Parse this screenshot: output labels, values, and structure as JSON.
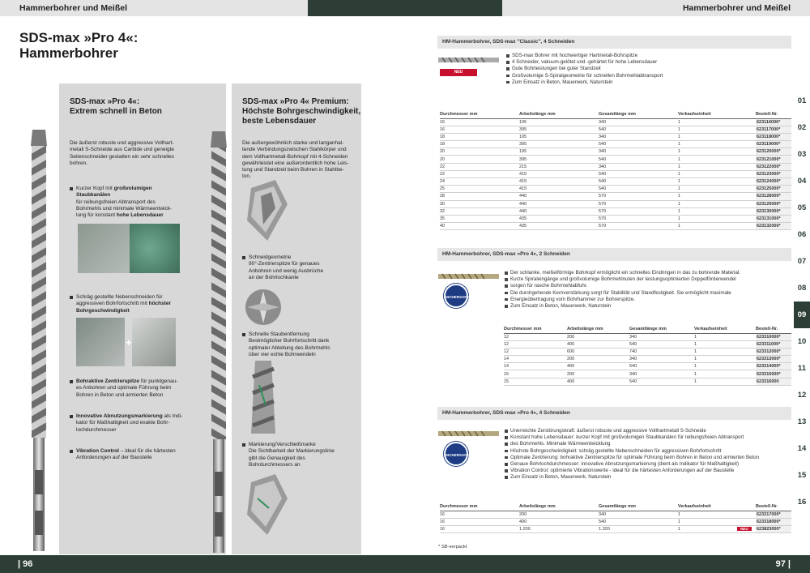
{
  "header": {
    "left_title": "Hammerbohrer und Meißel",
    "right_title": "Hammerbohrer und Meißel"
  },
  "footer": {
    "left_page": "| 96",
    "right_page": "97 |"
  },
  "main_title": {
    "line1": "SDS-max »Pro 4«:",
    "line2": "Hammerbohrer"
  },
  "col1": {
    "heading": [
      "SDS-max »Pro 4«:",
      "Extrem schnell in Beton"
    ],
    "intro": [
      "Die äußerst robuste und aggressive Voll­hart-",
      "metall S-Schneide aus Carbide und geneigte",
      "Seitenschneider gestatten ein sehr schnelles",
      "bohren."
    ],
    "b1_lines": [
      "Kurzer Kopf mit",
      "großvolumigen",
      "Staubkanälen",
      "für reibungsfreien Abtransport des",
      "Bohrmehls und minimale Wärmeentwick-",
      "lung für konstant",
      "hohe Lebensdauer"
    ],
    "b2_lines": [
      "Schräg gestellte Nebenschneiden für",
      "aggressiven Bohrfortschritt mit",
      "höchster",
      "Bohrgeschwindigkeit"
    ],
    "b3_lines": [
      "Bohraktive Zentrierspitze",
      "für punktgenau-",
      "es Anbohren und optimale Führung beim",
      "Bohren in Beton und armierten Beton"
    ],
    "b4_lines": [
      "Innovative Abnutzungsmarkierung",
      "als Indi-",
      "kator für Maßhaltigkeit und exakte Bohr-",
      "lochdurchmesser"
    ],
    "b5_lines": [
      "Vibration Control",
      "– ideal für die härtesten",
      "Anforderungen auf der Baustelle"
    ]
  },
  "col2": {
    "heading": [
      "SDS-max »Pro 4« Premium:",
      "Höchste Bohrgeschwindigkeit,",
      "beste Lebensdauer"
    ],
    "intro": [
      "Die außergewöhnlich starke und langanhal-",
      "tende Verbindungszwischen Stahlkörper und",
      "dem Vollhartmetall-Bohrkopf mit 4-Schneiden",
      "gewährleistet eine außerordentlich hohe Leis-",
      "tung und Standzeit beim Bohren in Stahlbe-",
      "ton."
    ],
    "b1": [
      "Schneidgeometrie",
      "90°-Zentrierspitze für genaues",
      "Anbohren und wenig Ausbrüche",
      "an der Bohrlochkante"
    ],
    "b2": [
      "Schnelle Staubentfernung",
      "Bestmöglicher Bohrfortschritt dank",
      "optimaler Ableitung des Bohrmehls",
      "über vier echte Bohrwendeln"
    ],
    "b3": [
      "Markierung/Verschleißmarke",
      "Die Sichtbarkeit der Markierungslinie",
      "gibt die Genauigkeit des",
      "Bohrdurchmessers an"
    ]
  },
  "sec1": {
    "title": "HM-Hammerbohrer, SDS-max \"Classic\", 4 Schneiden",
    "neu": "NEU",
    "bullets": [
      "SDS-max Bohrer mit hochwertiger Hartmetall-Bohrspitze",
      "4 Schneider, vakuum-gelötet und -gehärtet für hohe Lebensdauer",
      "Gute Bohrleistungen bei guter Standzeit",
      "Großvolumige S-Spiralgeometrie für schnellen Bohrmehlabtransport",
      "Zum Einsatz in Beton, Mauerwerk, Naturstein"
    ],
    "headers": [
      "Durchmesser mm",
      "Arbeitslänge mm",
      "Gesamtlänge mm",
      "Verkaufseinheit",
      "Bestell-Nr."
    ],
    "rows": [
      [
        "16",
        "195",
        "340",
        "1",
        "623116000*"
      ],
      [
        "16",
        "395",
        "540",
        "1",
        "623117000*"
      ],
      [
        "18",
        "195",
        "340",
        "1",
        "623118000*"
      ],
      [
        "18",
        "395",
        "540",
        "1",
        "623119000*"
      ],
      [
        "20",
        "195",
        "340",
        "1",
        "623120000*"
      ],
      [
        "20",
        "395",
        "540",
        "1",
        "623121000*"
      ],
      [
        "22",
        "215",
        "340",
        "1",
        "623122000*"
      ],
      [
        "22",
        "415",
        "540",
        "1",
        "623123000*"
      ],
      [
        "24",
        "415",
        "540",
        "1",
        "623124000*"
      ],
      [
        "25",
        "415",
        "540",
        "1",
        "623125000*"
      ],
      [
        "28",
        "440",
        "570",
        "1",
        "623128000*"
      ],
      [
        "30",
        "440",
        "570",
        "1",
        "623129000*"
      ],
      [
        "32",
        "440",
        "570",
        "1",
        "623130000*"
      ],
      [
        "35",
        "435",
        "570",
        "1",
        "623131000*"
      ],
      [
        "40",
        "435",
        "570",
        "1",
        "623132000*"
      ]
    ]
  },
  "sec2": {
    "title": "HM-Hammerbohrer, SDS-max »Pro 4«, 2 Schneiden",
    "badge": "SICHERSAFE",
    "bullets": [
      "Der schlanke, meißelförmige Bohrkopf ermöglicht ein schnelles Eindringen in das zu bohrende Material.",
      "Kurze Spiraleingänge und großvolumige Bohrmehlnuten der leistungsoptimierten Doppelförderwendel",
      "sorgen für rasche Bohrmehlabfuhr.",
      "Die durchgehende Kernverstärkung sorgt für Stabilität und Standfestigkeit. Sie ermöglicht maximale",
      "Energieübertragung vom Bohrhammer zur Bohrerspitze.",
      "Zum Einsatz in Beton, Mauerwerk, Naturstein"
    ],
    "headers": [
      "Durchmesser mm",
      "Arbeitslänge mm",
      "Gesamtlänge mm",
      "Verkaufseinheit",
      "Bestell-Nr."
    ],
    "rows": [
      [
        "12",
        "200",
        "340",
        "1",
        "623310000*"
      ],
      [
        "12",
        "400",
        "540",
        "1",
        "623311000*"
      ],
      [
        "12",
        "600",
        "740",
        "1",
        "623312000*"
      ],
      [
        "14",
        "200",
        "340",
        "1",
        "623313000*"
      ],
      [
        "14",
        "400",
        "540",
        "1",
        "623314000*"
      ],
      [
        "15",
        "200",
        "340",
        "1",
        "623315000*"
      ],
      [
        "15",
        "400",
        "540",
        "1",
        "623316000"
      ]
    ]
  },
  "sec3": {
    "title": "HM-Hammerbohrer, SDS-max »Pro 4«, 4 Schneiden",
    "badge": "SICHERSAFE",
    "bullets": [
      "Unerreichte Zerstörungskraft: äußerst robuste und aggressive Vollhartmetall S-Schneide",
      "Konstant hohe Lebensdauer: kurzer Kopf mit großvolumigen Staubkanälen für reibungsfreien Abtransport",
      "des Bohrmehls. Minimale Wärmeentwicklung",
      "Höchste Bohrgeschwindigkeit: schräg gestellte Nebenschneiden für aggressiven Bohrfortschritt",
      "Optimale Zentrierung: bohraktive Zentrierspitze für optimale Führung beim Bohren in Beton und armierten Beton",
      "Genaue Bohrlochdurchmesser: innovative Abnutzungsmarkierung (dient als Indikator für Maßhaltigkeit)",
      "Vibration Control: optimierte Vibrationswerte - ideal für die härtesten Anforderungen auf der Baustelle",
      "Zum Einsatz in Beton, Mauerwerk, Naturstein"
    ],
    "headers": [
      "Durchmesser mm",
      "Arbeitslänge mm",
      "Gesamtlänge mm",
      "Verkaufseinheit",
      "Bestell-Nr."
    ],
    "rows": [
      [
        "16",
        "200",
        "340",
        "1",
        "623317000*"
      ],
      [
        "16",
        "400",
        "540",
        "1",
        "623318000*"
      ],
      [
        "16",
        "1.200",
        "1.320",
        "1",
        "623823000*"
      ]
    ],
    "neu": "NEU"
  },
  "footnote": "* SB-verpackt",
  "tabs": [
    "01",
    "02",
    "03",
    "04",
    "05",
    "06",
    "07",
    "08",
    "09",
    "10",
    "11",
    "12",
    "13",
    "14",
    "15",
    "16"
  ],
  "active_tab": "09",
  "colors": {
    "dark_green": "#2c3e35",
    "red": "#c8102e",
    "grey_bg": "#d8d8d8",
    "badge_blue": "#1d3c84"
  }
}
